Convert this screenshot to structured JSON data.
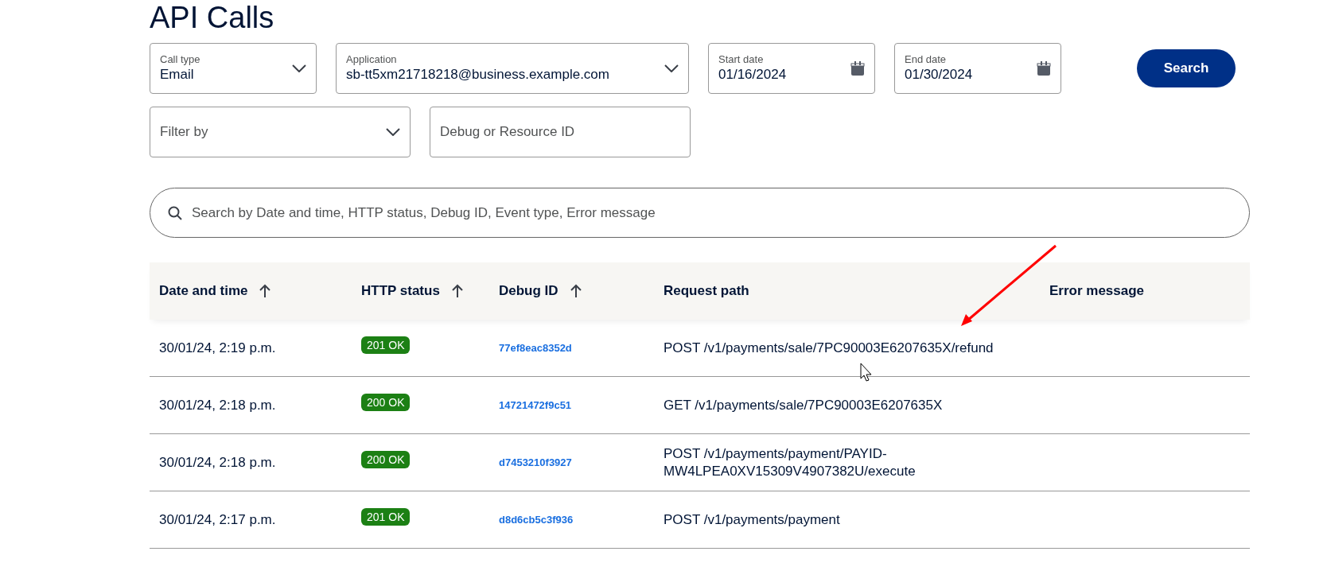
{
  "page_title": "API Calls",
  "filters": [
    {
      "kind": "select",
      "label": "Call type",
      "value": "Email"
    },
    {
      "kind": "select",
      "label": "Application",
      "value": "sb-tt5xm21718218@business.example.com"
    },
    {
      "kind": "date",
      "label": "Start date",
      "value": "01/16/2024"
    },
    {
      "kind": "date",
      "label": "End date",
      "value": "01/30/2024"
    }
  ],
  "search_button": "Search",
  "filters_row_2": [
    {
      "kind": "select",
      "placeholder": "Filter by"
    },
    {
      "kind": "text",
      "placeholder": "Debug or Resource ID"
    }
  ],
  "search": {
    "placeholder": "Search by Date and time, HTTP status, Debug ID, Event type, Error message"
  },
  "table": {
    "columns": [
      {
        "label": "Date and time",
        "sortable": true
      },
      {
        "label": "HTTP status",
        "sortable": true
      },
      {
        "label": "Debug ID",
        "sortable": true
      },
      {
        "label": "Request path",
        "sortable": false
      },
      {
        "label": "Error message",
        "sortable": false
      }
    ],
    "rows": [
      {
        "date": "30/01/24, 2:19 p.m.",
        "status": "201 OK",
        "debug_id": "77ef8eac8352d",
        "path": "POST /v1/payments/sale/7PC90003E6207635X/refund"
      },
      {
        "date": "30/01/24, 2:18 p.m.",
        "status": "200 OK",
        "debug_id": "14721472f9c51",
        "path": "GET /v1/payments/sale/7PC90003E6207635X"
      },
      {
        "date": "30/01/24, 2:18 p.m.",
        "status": "200 OK",
        "debug_id": "d7453210f3927",
        "path": "POST /v1/payments/payment/PAYID-MW4LPEA0XV15309V4907382U/execute"
      },
      {
        "date": "30/01/24, 2:17 p.m.",
        "status": "201 OK",
        "debug_id": "d8d6cb5c3f936",
        "path": "POST /v1/payments/payment"
      }
    ]
  }
}
